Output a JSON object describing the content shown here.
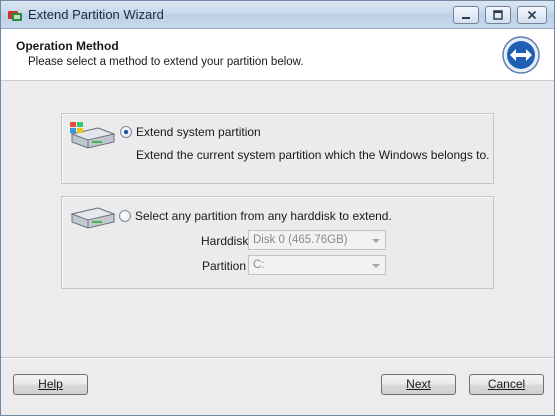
{
  "window": {
    "title": "Extend Partition Wizard"
  },
  "header": {
    "title": "Operation Method",
    "subtitle": "Please select a method to extend your partition below."
  },
  "options": {
    "system": {
      "label": "Extend system partition",
      "description": "Extend the current system partition which the Windows belongs to.",
      "selected": true
    },
    "any": {
      "label": "Select any partition from any harddisk to extend.",
      "selected": false,
      "harddisk_label": "Harddisk",
      "harddisk_value": "Disk 0 (465.76GB)",
      "partition_label": "Partition",
      "partition_value": "C:"
    }
  },
  "buttons": {
    "help": "Help",
    "next": "Next",
    "cancel": "Cancel"
  },
  "icons": {
    "app": "partition-wizard-app-icon",
    "header": "extend-arrows-icon",
    "disk": "hard-disk-icon",
    "system_disk": "windows-system-disk-icon"
  },
  "colors": {
    "accent": "#1e5fb3",
    "header_bg": "#ffffff",
    "dialog_bg": "#ececec"
  }
}
